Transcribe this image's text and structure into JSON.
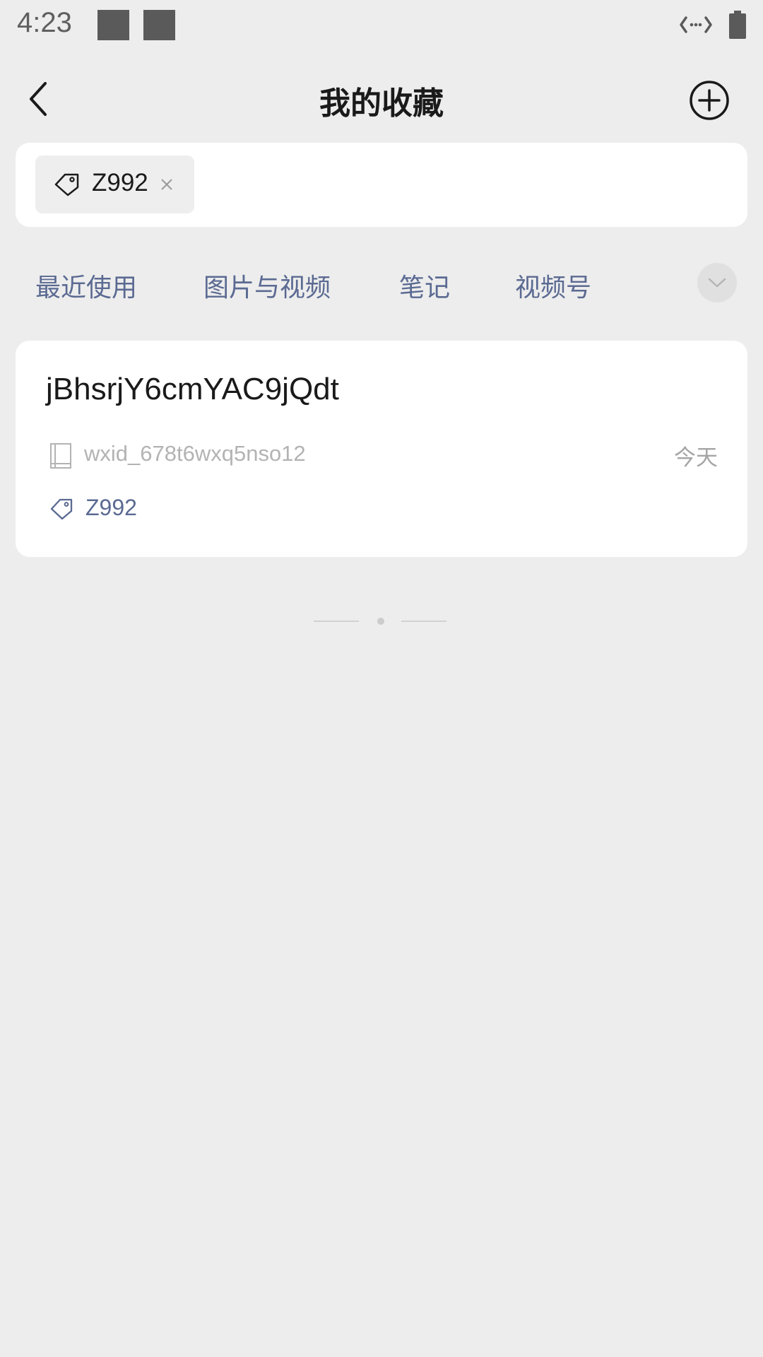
{
  "status_bar": {
    "time": "4:23",
    "icons": [
      "notification-square-icon",
      "notification-square-icon",
      "data-transfer-icon",
      "battery-icon"
    ]
  },
  "header": {
    "title": "我的收藏",
    "back_icon": "chevron-left-icon",
    "add_icon": "plus-circle-icon"
  },
  "filter": {
    "selected_tag": "Z992",
    "tag_icon": "tag-icon",
    "remove_icon": "close-icon"
  },
  "tabs": [
    {
      "label": "最近使用"
    },
    {
      "label": "图片与视频"
    },
    {
      "label": "笔记"
    },
    {
      "label": "视频号"
    }
  ],
  "tabs_more_icon": "chevron-down-icon",
  "items": [
    {
      "title": "jBhsrjY6cmYAC9jQdt",
      "source": "wxid_678t6wxq5nso12",
      "date": "今天",
      "tag": "Z992"
    }
  ],
  "colors": {
    "background": "#ededed",
    "card": "#ffffff",
    "accent_text": "#5b6a92",
    "title_text": "#1a1a1a",
    "secondary_text": "#b3b3b3"
  }
}
